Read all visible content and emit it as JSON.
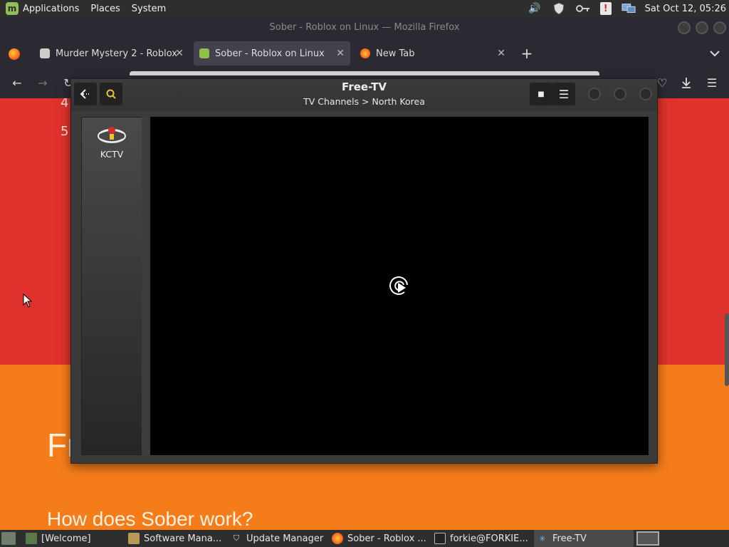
{
  "top_panel": {
    "menus": [
      "Applications",
      "Places",
      "System"
    ],
    "clock": "Sat Oct 12, 05:26"
  },
  "firefox": {
    "window_title": "Sober - Roblox on Linux — Mozilla Firefox",
    "tabs": [
      {
        "title": "Murder Mystery 2 - Roblox",
        "active": false
      },
      {
        "title": "Sober - Roblox on Linux",
        "active": true
      },
      {
        "title": "New Tab",
        "active": false
      }
    ],
    "new_tab_label": "+",
    "tab_list_icon": "chevron-down-icon"
  },
  "page": {
    "list_numbers": [
      "4",
      "5"
    ],
    "heading_partial": "Fr",
    "subheading": "How does Sober work?",
    "colors": {
      "red": "#e0322c",
      "orange": "#f57c1a"
    }
  },
  "freetv": {
    "title": "Free-TV",
    "breadcrumb": "TV Channels > North Korea",
    "channels": [
      {
        "name": "KCTV"
      }
    ],
    "stop_glyph": "■",
    "menu_glyph": "☰",
    "back_glyph": "⇠"
  },
  "taskbar": {
    "tasks": [
      {
        "label": "[Welcome]",
        "icon": "terminal-icon"
      },
      {
        "label": "Software Mana...",
        "icon": "software-manager-icon"
      },
      {
        "label": "Update Manager",
        "icon": "shield-icon"
      },
      {
        "label": "Sober - Roblox ...",
        "icon": "firefox-icon"
      },
      {
        "label": "forkie@FORKIE...",
        "icon": "terminal-icon"
      },
      {
        "label": "Free-TV",
        "icon": "freetv-icon",
        "active": true
      }
    ]
  }
}
